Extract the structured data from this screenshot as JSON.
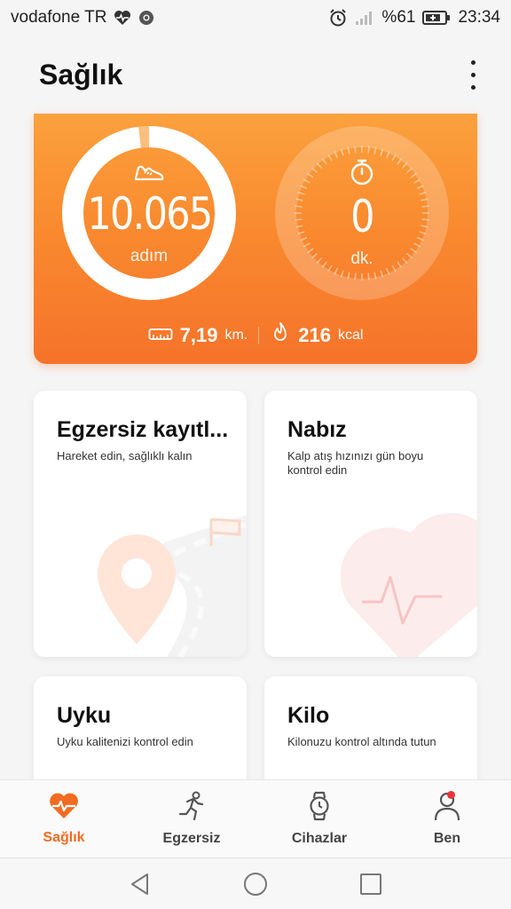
{
  "status_bar": {
    "carrier": "vodafone TR",
    "battery_percent": "%61",
    "time": "23:34"
  },
  "header": {
    "title": "Sağlık"
  },
  "hero": {
    "steps_value": "10.065",
    "steps_unit": "adım",
    "steps_goal_progress": 0.98,
    "time_value": "0",
    "time_unit": "dk.",
    "distance_value": "7,19",
    "distance_unit": "km.",
    "calories_value": "216",
    "calories_unit": "kcal",
    "colors": {
      "top": "#fba13d",
      "bottom": "#f6732a"
    }
  },
  "cards": [
    {
      "title": "Egzersiz kayıtl...",
      "description": "Hareket edin, sağlıklı kalın"
    },
    {
      "title": "Nabız",
      "description": "Kalp atış hızınızı gün boyu kontrol edin"
    },
    {
      "title": "Uyku",
      "description": "Uyku kalitenizi kontrol edin"
    },
    {
      "title": "Kilo",
      "description": "Kilonuzu kontrol altında tutun"
    }
  ],
  "bottom_nav": [
    {
      "label": "Sağlık",
      "icon": "heart-pulse-icon",
      "active": true
    },
    {
      "label": "Egzersiz",
      "icon": "runner-icon",
      "active": false
    },
    {
      "label": "Cihazlar",
      "icon": "watch-icon",
      "active": false
    },
    {
      "label": "Ben",
      "icon": "person-icon",
      "active": false,
      "badge": true
    }
  ],
  "accent_color": "#f26b21"
}
